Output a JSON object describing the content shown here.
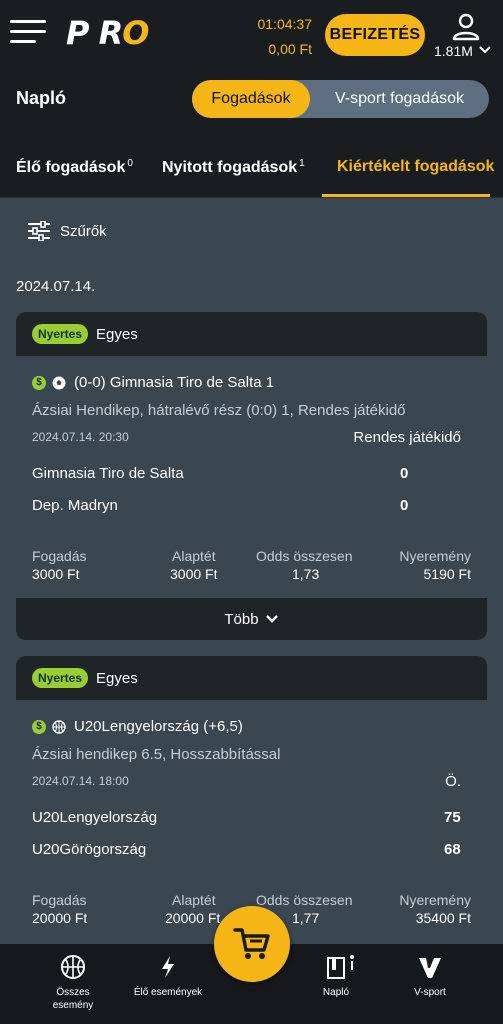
{
  "header": {
    "logo_text": "PRO",
    "time": "01:04:37",
    "balance": "0,00 Ft",
    "deposit_label": "BEFIZETÉS",
    "user_amount": "1.81M"
  },
  "subheader": {
    "title": "Napló",
    "segments": [
      "Fogadások",
      "V-sport fogadások"
    ]
  },
  "tabs": [
    {
      "label": "Élő fogadások",
      "count": "0"
    },
    {
      "label": "Nyitott fogadások",
      "count": "1"
    },
    {
      "label": "Kiértékelt fogadások",
      "count": ""
    }
  ],
  "filter": {
    "label": "Szűrők"
  },
  "date": "2024.07.14.",
  "cards": [
    {
      "status": "Nyertes",
      "type": "Egyes",
      "selection": "(0-0) Gimnasia Tiro de Salta 1",
      "market": "Ázsiai Hendikep, hátralévő rész (0:0) 1, Rendes játékidő",
      "event_date": "2024.07.14.  20:30",
      "period": "Rendes játékidő",
      "team1": "Gimnasia Tiro de Salta",
      "score1": "0",
      "team2": "Dep. Madryn",
      "score2": "0",
      "stake_label": "Fogadás",
      "stake": "3000 Ft",
      "base_label": "Alaptét",
      "base": "3000 Ft",
      "odds_label": "Odds összesen",
      "odds": "1,73",
      "win_label": "Nyeremény",
      "win": "5190 Ft",
      "more_label": "Több"
    },
    {
      "status": "Nyertes",
      "type": "Egyes",
      "selection": "U20Lengyelország (+6,5)",
      "market": "Ázsiai hendikep 6.5, Hosszabbítással",
      "event_date": "2024.07.14.  18:00",
      "period": "Ö.",
      "team1": "U20Lengyelország",
      "score1": "75",
      "team2": "U20Görögország",
      "score2": "68",
      "stake_label": "Fogadás",
      "stake": "20000 Ft",
      "base_label": "Alaptét",
      "base": "20000 Ft",
      "odds_label": "Odds összesen",
      "odds": "1,77",
      "win_label": "Nyeremény",
      "win": "35400 Ft"
    }
  ],
  "bottom_nav": [
    {
      "label": "Összes esemény",
      "icon": "basketball-icon"
    },
    {
      "label": "Élő események",
      "icon": "lightning-icon"
    },
    {
      "label": "",
      "icon": "cart-icon"
    },
    {
      "label": "Napló",
      "icon": "journal-icon"
    },
    {
      "label": "V-sport",
      "icon": "vsport-icon"
    }
  ],
  "colors": {
    "accent": "#f6b616",
    "win_badge": "#9acd32",
    "bg": "#3a4650",
    "header_bg": "#1a1d20"
  }
}
